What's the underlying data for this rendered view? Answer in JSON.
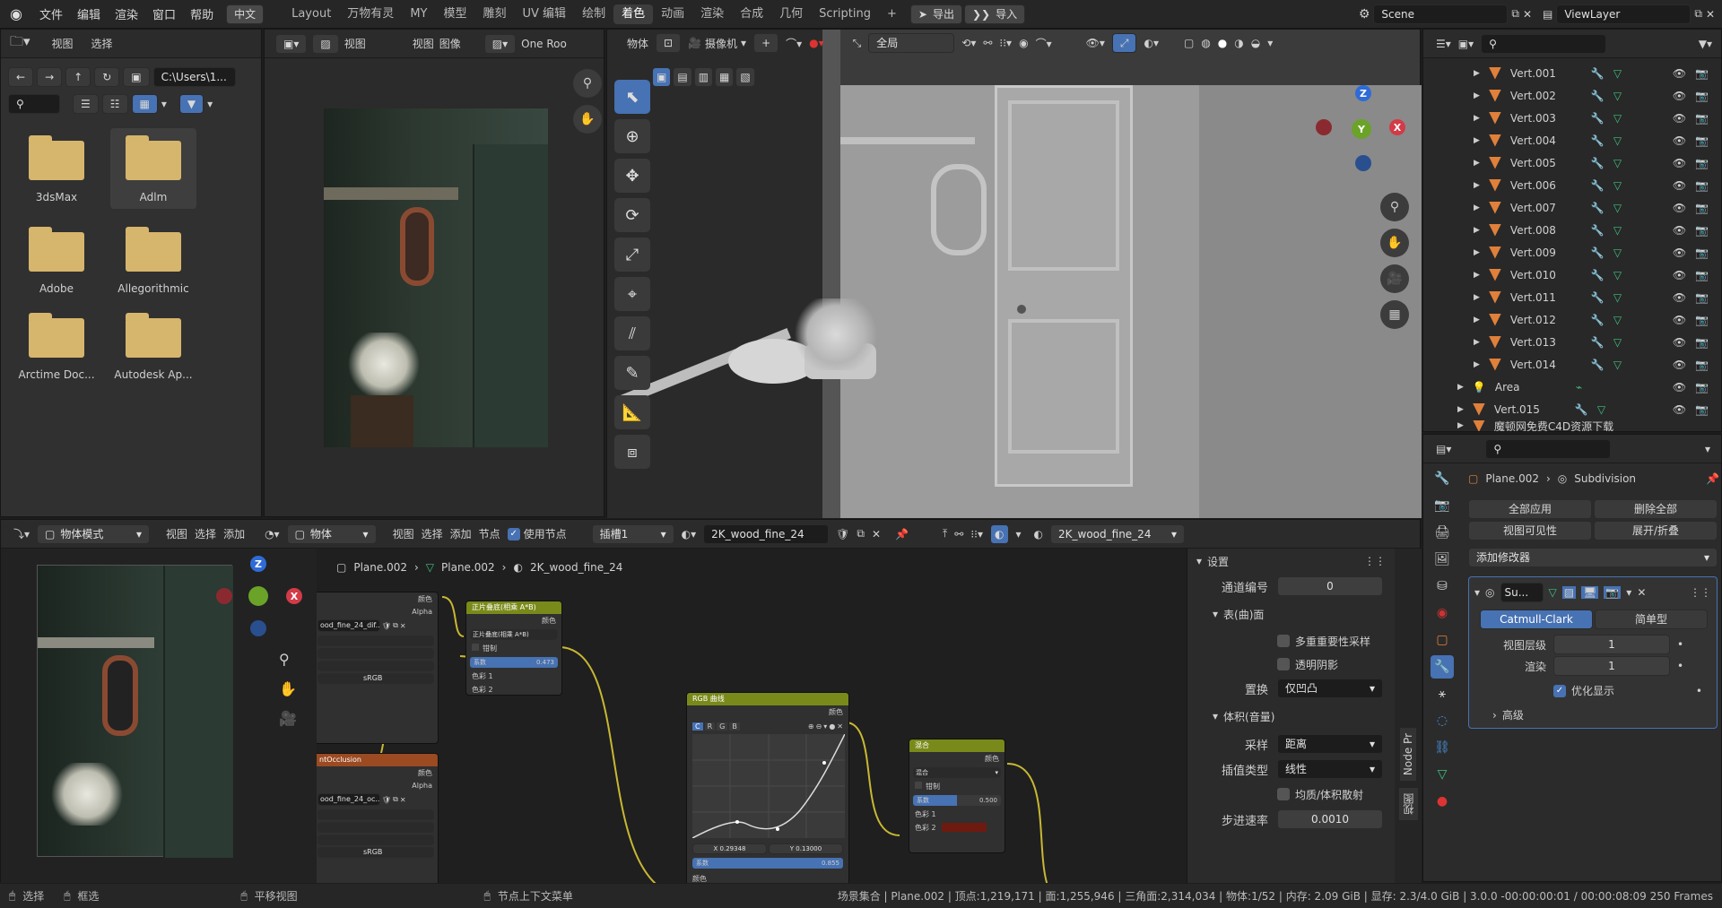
{
  "topbar": {
    "menus": [
      "文件",
      "编辑",
      "渲染",
      "窗口",
      "帮助"
    ],
    "lang": "中文",
    "workspaces": [
      "Layout",
      "万物有灵",
      "MY",
      "模型",
      "雕刻",
      "UV 编辑",
      "绘制",
      "着色",
      "动画",
      "渲染",
      "合成",
      "几何",
      "Scripting"
    ],
    "active_workspace": "着色",
    "export": "导出",
    "import": "导入",
    "scene": "Scene",
    "viewlayer": "ViewLayer"
  },
  "filebrowser": {
    "menu": [
      "视图",
      "选择"
    ],
    "path": "C:\\Users\\1...",
    "folders": [
      "3dsMax",
      "Adlm",
      "Adobe",
      "Allegorithmic",
      "Arctime Doc...",
      "Autodesk Ap..."
    ]
  },
  "imageviewer": {
    "menu": [
      "视图",
      "图像"
    ],
    "name": "One Roo"
  },
  "viewport": {
    "obj": "物体",
    "camera": "摄像机",
    "orient": "全局"
  },
  "outliner": {
    "items": [
      "Vert.001",
      "Vert.002",
      "Vert.003",
      "Vert.004",
      "Vert.005",
      "Vert.006",
      "Vert.007",
      "Vert.008",
      "Vert.009",
      "Vert.010",
      "Vert.011",
      "Vert.012",
      "Vert.013",
      "Vert.014"
    ],
    "area": "Area",
    "vert15": "Vert.015",
    "last": "魔顿网免费C4D资源下载"
  },
  "properties": {
    "object": "Plane.002",
    "modifier": "Subdivision",
    "apply_all": "全部应用",
    "delete_all": "删除全部",
    "viewport_vis": "视图可见性",
    "expand": "展开/折叠",
    "add_modifier": "添加修改器",
    "mod_name": "Su...",
    "catmull": "Catmull-Clark",
    "simple": "简单型",
    "levels_label": "视图层级",
    "levels_val": "1",
    "render_label": "渲染",
    "render_val": "1",
    "optimal": "优化显示",
    "advanced": "高级"
  },
  "node_header": {
    "mode": "物体模式",
    "menu": [
      "视图",
      "选择",
      "添加"
    ],
    "obj": "物体",
    "menu2": [
      "视图",
      "选择",
      "添加",
      "节点"
    ],
    "use_nodes": "使用节点",
    "slot": "插槽1",
    "material": "2K_wood_fine_24",
    "material2": "2K_wood_fine_24"
  },
  "breadcrumb": [
    "Plane.002",
    "Plane.002",
    "2K_wood_fine_24"
  ],
  "nodes": {
    "overlay": {
      "title": "正片叠底(相乘 A*B)",
      "out": "颜色",
      "mode": "正片叠底(相乘 A*B)",
      "clamp": "钳制",
      "fac_label": "系数",
      "fac": "0.473",
      "c1": "色彩 1",
      "c2": "色彩 2"
    },
    "rgb": {
      "title": "RGB 曲线",
      "out": "颜色",
      "tabs": [
        "C",
        "R",
        "G",
        "B"
      ],
      "x": "X 0.29348",
      "y": "Y 0.13000",
      "fac_label": "系数",
      "fac": "0.855",
      "in": "颜色"
    },
    "mix": {
      "title": "混合",
      "out": "颜色",
      "mode": "混合",
      "clamp": "钳制",
      "fac_label": "系数",
      "fac": "0.500",
      "c1": "色彩 1",
      "c2": "色彩 2"
    },
    "tex1": {
      "name": "ood_fine_24_dif...",
      "color": "颜色",
      "alpha": "Alpha",
      "cs": "sRGB"
    },
    "tex2": {
      "title": "ntOcclusion",
      "name": "ood_fine_24_oc...",
      "color": "颜色",
      "alpha": "Alpha",
      "cs": "sRGB"
    }
  },
  "sidepanel": {
    "settings": "设置",
    "pass_label": "通道编号",
    "pass_val": "0",
    "surface": "表(曲)面",
    "multi": "多重重要性采样",
    "transparent": "透明阴影",
    "disp_label": "置换",
    "disp_val": "仅凹凸",
    "volume": "体积(音量)",
    "sampling_label": "采样",
    "sampling_val": "距离",
    "interp_label": "插值类型",
    "interp_val": "线性",
    "homog": "均质/体积散射",
    "step_label": "步进速率",
    "step_val": "0.0010",
    "tab_node": "Node Pr",
    "tab_other": "视图"
  },
  "statusbar": {
    "select": "选择",
    "box": "框选",
    "pan": "平移视图",
    "ctx": "节点上下文菜单",
    "stats": "场景集合 | Plane.002 | 顶点:1,219,171 | 面:1,255,946 | 三角面:2,314,034 | 物体:1/52 | 内存: 2.09 GiB | 显存: 2.3/4.0 GiB | 3.0.0 -00:00:00:01 / 00:00:08:09  250 Frames"
  }
}
